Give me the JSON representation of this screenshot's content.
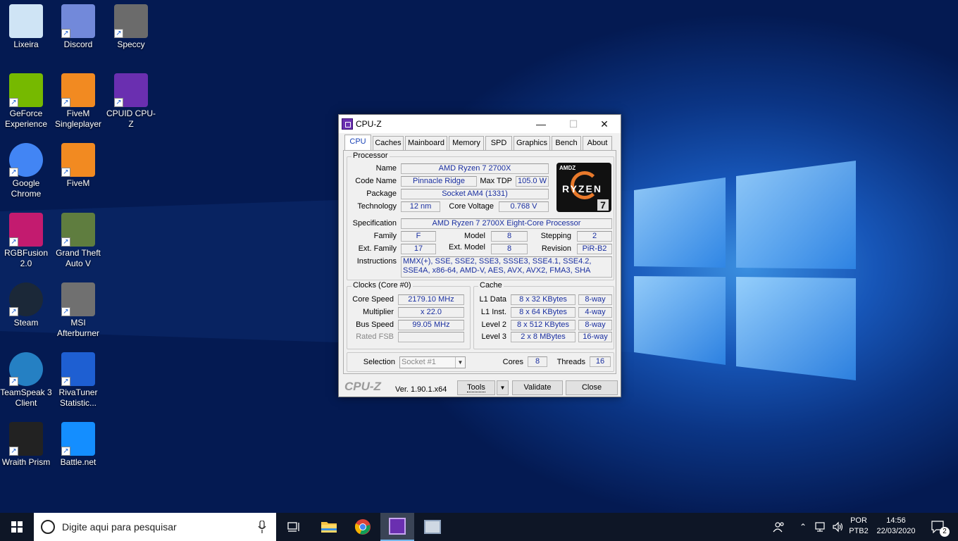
{
  "desktop": {
    "icons": [
      {
        "label": "Lixeira",
        "icon": "recycle-bin-icon"
      },
      {
        "label": "Discord",
        "icon": "discord-icon"
      },
      {
        "label": "Speccy",
        "icon": "speccy-icon"
      },
      {
        "label": "GeForce Experience",
        "icon": "nvidia-icon"
      },
      {
        "label": "FiveM Singleplayer",
        "icon": "fivem-icon"
      },
      {
        "label": "CPUID CPU-Z",
        "icon": "cpuz-icon"
      },
      {
        "label": "Google Chrome",
        "icon": "chrome-icon"
      },
      {
        "label": "FiveM",
        "icon": "fivem-icon"
      },
      {
        "label": "RGBFusion 2.0",
        "icon": "rgbfusion-icon"
      },
      {
        "label": "Grand Theft Auto V",
        "icon": "gtav-icon"
      },
      {
        "label": "Steam",
        "icon": "steam-icon"
      },
      {
        "label": "MSI Afterburner",
        "icon": "afterburner-icon"
      },
      {
        "label": "TeamSpeak 3 Client",
        "icon": "teamspeak-icon"
      },
      {
        "label": "RivaTuner Statistic...",
        "icon": "rivatuner-icon"
      },
      {
        "label": "Wraith Prism",
        "icon": "coolermaster-icon"
      },
      {
        "label": "Battle.net",
        "icon": "battlenet-icon"
      }
    ]
  },
  "cpuz": {
    "title": "CPU-Z",
    "tabs": [
      "CPU",
      "Caches",
      "Mainboard",
      "Memory",
      "SPD",
      "Graphics",
      "Bench",
      "About"
    ],
    "active_tab": "CPU",
    "processor": {
      "group_label": "Processor",
      "name_label": "Name",
      "name": "AMD Ryzen 7 2700X",
      "codename_label": "Code Name",
      "codename": "Pinnacle Ridge",
      "maxtdp_label": "Max TDP",
      "maxtdp": "105.0 W",
      "package_label": "Package",
      "package": "Socket AM4 (1331)",
      "technology_label": "Technology",
      "technology": "12 nm",
      "corevoltage_label": "Core Voltage",
      "corevoltage": "0.768 V",
      "spec_label": "Specification",
      "spec": "AMD Ryzen 7 2700X Eight-Core Processor",
      "family_label": "Family",
      "family": "F",
      "model_label": "Model",
      "model": "8",
      "stepping_label": "Stepping",
      "stepping": "2",
      "extfamily_label": "Ext. Family",
      "extfamily": "17",
      "extmodel_label": "Ext. Model",
      "extmodel": "8",
      "revision_label": "Revision",
      "revision": "PiR-B2",
      "instructions_label": "Instructions",
      "instructions": "MMX(+), SSE, SSE2, SSE3, SSSE3, SSE4.1, SSE4.2, SSE4A, x86-64, AMD-V, AES, AVX, AVX2, FMA3, SHA",
      "logo": {
        "brand": "AMDZ",
        "line": "RYZEN",
        "tier": "7"
      }
    },
    "clocks": {
      "group_label": "Clocks (Core #0)",
      "corespeed_label": "Core Speed",
      "corespeed": "2179.10 MHz",
      "multiplier_label": "Multiplier",
      "multiplier": "x 22.0",
      "busspeed_label": "Bus Speed",
      "busspeed": "99.05 MHz",
      "ratedfsb_label": "Rated FSB",
      "ratedfsb": ""
    },
    "cache": {
      "group_label": "Cache",
      "rows": [
        {
          "label": "L1 Data",
          "size": "8 x 32 KBytes",
          "way": "8-way"
        },
        {
          "label": "L1 Inst.",
          "size": "8 x 64 KBytes",
          "way": "4-way"
        },
        {
          "label": "Level 2",
          "size": "8 x 512 KBytes",
          "way": "8-way"
        },
        {
          "label": "Level 3",
          "size": "2 x 8 MBytes",
          "way": "16-way"
        }
      ]
    },
    "selection": {
      "label": "Selection",
      "value": "Socket #1",
      "cores_label": "Cores",
      "cores": "8",
      "threads_label": "Threads",
      "threads": "16"
    },
    "footer": {
      "brand": "CPU-Z",
      "version": "Ver. 1.90.1.x64",
      "tools": "Tools",
      "validate": "Validate",
      "close": "Close"
    }
  },
  "taskbar": {
    "search_placeholder": "Digite aqui para pesquisar",
    "lang_top": "POR",
    "lang_bottom": "PTB2",
    "time": "14:56",
    "date": "22/03/2020",
    "notifications": "2"
  }
}
